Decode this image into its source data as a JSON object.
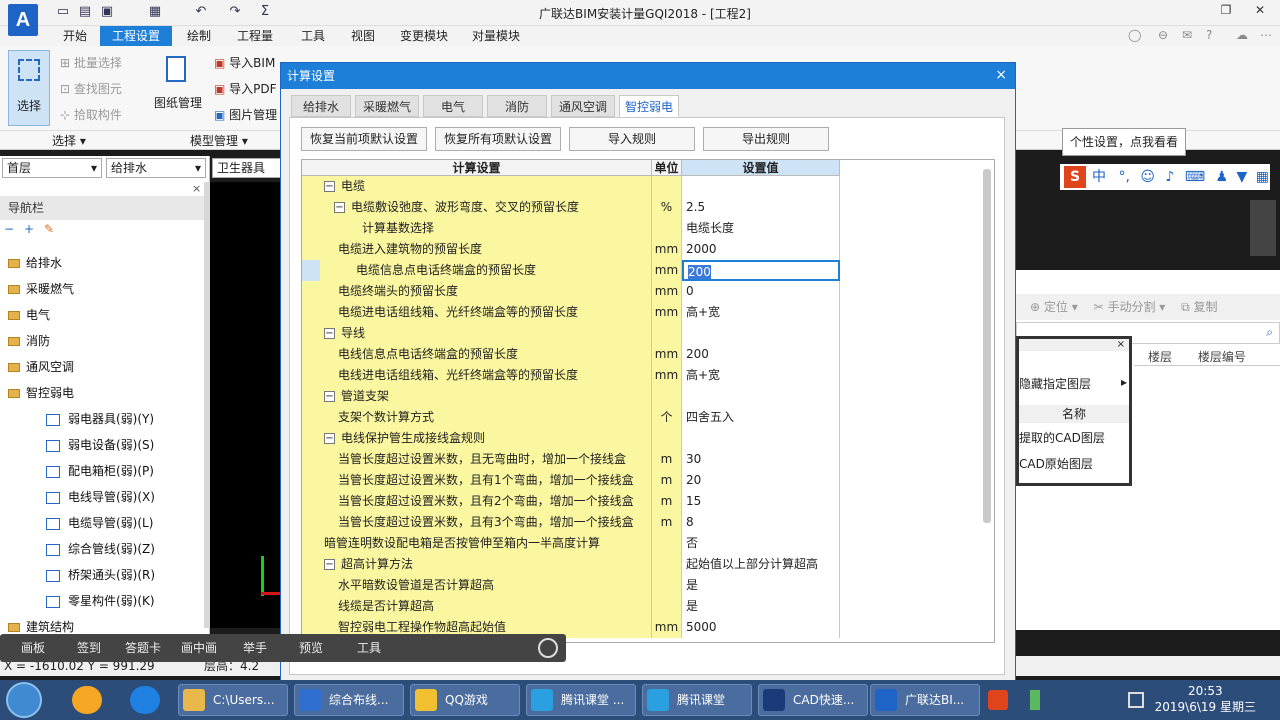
{
  "app": {
    "logo": "A",
    "title": "广联达BIM安装计量GQI2018 - [工程2]"
  },
  "menubar": {
    "tabs": [
      "开始",
      "工程设置",
      "绘制",
      "工程量",
      "工具",
      "视图",
      "变更模块",
      "对量模块"
    ],
    "active_index": 1
  },
  "ribbon": {
    "select_label": "选择",
    "batch_select": "批量选择",
    "find_elem": "查找图元",
    "pick_comp": "拾取构件",
    "drawing_mgmt": "图纸管理",
    "import_bim": "导入BIM",
    "import_pdf": "导入PDF",
    "image_mgmt": "图片管理",
    "group_select": "选择",
    "group_model": "模型管理"
  },
  "left": {
    "floor_value": "首层",
    "discipline_value": "给排水",
    "component_value": "卫生器具(水",
    "nav_title": "导航栏",
    "items": [
      {
        "label": "给排水",
        "level": 0
      },
      {
        "label": "采暖燃气",
        "level": 0
      },
      {
        "label": "电气",
        "level": 0
      },
      {
        "label": "消防",
        "level": 0
      },
      {
        "label": "通风空调",
        "level": 0
      },
      {
        "label": "智控弱电",
        "level": 0
      },
      {
        "label": "弱电器具(弱)(Y)",
        "level": 1
      },
      {
        "label": "弱电设备(弱)(S)",
        "level": 1
      },
      {
        "label": "配电箱柜(弱)(P)",
        "level": 1
      },
      {
        "label": "电线导管(弱)(X)",
        "level": 1
      },
      {
        "label": "电缆导管(弱)(L)",
        "level": 1
      },
      {
        "label": "综合管线(弱)(Z)",
        "level": 1
      },
      {
        "label": "桥架通头(弱)(R)",
        "level": 1
      },
      {
        "label": "零星构件(弱)(K)",
        "level": 1
      },
      {
        "label": "建筑结构",
        "level": 0
      }
    ]
  },
  "dialog": {
    "title": "计算设置",
    "close": "×",
    "tabs": [
      "给排水",
      "采暖燃气",
      "电气",
      "消防",
      "通风空调",
      "智控弱电"
    ],
    "active_tab": 5,
    "buttons": {
      "restore_current": "恢复当前项默认设置",
      "restore_all": "恢复所有项默认设置",
      "import_rules": "导入规则",
      "export_rules": "导出规则"
    },
    "grid_headers": {
      "name": "计算设置",
      "unit": "单位",
      "value": "设置值"
    },
    "rows": [
      {
        "name": "电缆",
        "unit": "",
        "value": "",
        "indent": 0,
        "toggle": "−"
      },
      {
        "name": "电缆敷设弛度、波形弯度、交叉的预留长度",
        "unit": "%",
        "value": "2.5",
        "indent": 1,
        "toggle": "−"
      },
      {
        "name": "计算基数选择",
        "unit": "",
        "value": "电缆长度",
        "indent": 2,
        "toggle": ""
      },
      {
        "name": "电缆进入建筑物的预留长度",
        "unit": "mm",
        "value": "2000",
        "indent": 1,
        "toggle": ""
      },
      {
        "name": "电缆信息点电话终端盒的预留长度",
        "unit": "mm",
        "value": "200",
        "indent": 1,
        "toggle": "",
        "selected": true
      },
      {
        "name": "电缆终端头的预留长度",
        "unit": "mm",
        "value": "0",
        "indent": 1,
        "toggle": ""
      },
      {
        "name": "电缆进电话组线箱、光纤终端盒等的预留长度",
        "unit": "mm",
        "value": "高+宽",
        "indent": 1,
        "toggle": ""
      },
      {
        "name": "导线",
        "unit": "",
        "value": "",
        "indent": 0,
        "toggle": "−"
      },
      {
        "name": "电线信息点电话终端盒的预留长度",
        "unit": "mm",
        "value": "200",
        "indent": 1,
        "toggle": ""
      },
      {
        "name": "电线进电话组线箱、光纤终端盒等的预留长度",
        "unit": "mm",
        "value": "高+宽",
        "indent": 1,
        "toggle": ""
      },
      {
        "name": "管道支架",
        "unit": "",
        "value": "",
        "indent": 0,
        "toggle": "−"
      },
      {
        "name": "支架个数计算方式",
        "unit": "个",
        "value": "四舍五入",
        "indent": 1,
        "toggle": ""
      },
      {
        "name": "电线保护管生成接线盒规则",
        "unit": "",
        "value": "",
        "indent": 0,
        "toggle": "−"
      },
      {
        "name": "当管长度超过设置米数，且无弯曲时，增加一个接线盒",
        "unit": "m",
        "value": "30",
        "indent": 1,
        "toggle": ""
      },
      {
        "name": "当管长度超过设置米数，且有1个弯曲，增加一个接线盒",
        "unit": "m",
        "value": "20",
        "indent": 1,
        "toggle": ""
      },
      {
        "name": "当管长度超过设置米数，且有2个弯曲，增加一个接线盒",
        "unit": "m",
        "value": "15",
        "indent": 1,
        "toggle": ""
      },
      {
        "name": "当管长度超过设置米数，且有3个弯曲，增加一个接线盒",
        "unit": "m",
        "value": "8",
        "indent": 1,
        "toggle": ""
      },
      {
        "name": "暗管连明数设配电箱是否按管伸至箱内一半高度计算",
        "unit": "",
        "value": "否",
        "indent": 0,
        "toggle": ""
      },
      {
        "name": "超高计算方法",
        "unit": "",
        "value": "起始值以上部分计算超高",
        "indent": 0,
        "toggle": "−"
      },
      {
        "name": "水平暗数设管道是否计算超高",
        "unit": "",
        "value": "是",
        "indent": 1,
        "toggle": ""
      },
      {
        "name": "线缆是否计算超高",
        "unit": "",
        "value": "是",
        "indent": 1,
        "toggle": ""
      },
      {
        "name": "智控弱电工程操作物超高起始值",
        "unit": "mm",
        "value": "5000",
        "indent": 1,
        "toggle": ""
      }
    ]
  },
  "right": {
    "tooltip": "个性设置，点我看看",
    "ime_logo": "S",
    "ime_mode": "中",
    "locate": "定位",
    "manual_split": "手动分割",
    "copy": "复制",
    "col_floor": "楼层",
    "col_floor_no": "楼层编号",
    "hide_layers": "隐藏指定图层",
    "col_name": "名称",
    "extracted_cad": "提取的CAD图层",
    "original_layer": "CAD原始图层"
  },
  "floatbar": {
    "items": [
      "画板",
      "签到",
      "答题卡",
      "画中画",
      "举手",
      "预览",
      "工具"
    ]
  },
  "statusbar": {
    "coords": "X = -1610.02 Y = 991.29",
    "floor_height": "层高：4.2"
  },
  "taskbar": {
    "items": [
      {
        "label": "C:\\Users...",
        "color": "#e8b84a"
      },
      {
        "label": "综合布线...",
        "color": "#2e6fd0"
      },
      {
        "label": "QQ游戏",
        "color": "#f0c030"
      },
      {
        "label": "腾讯课堂 ...",
        "color": "#2ba0e0"
      },
      {
        "label": "腾讯课堂",
        "color": "#2ba0e0"
      },
      {
        "label": "CAD快速...",
        "color": "#1a3a7a"
      },
      {
        "label": "广联达BI...",
        "color": "#1e63c6"
      }
    ],
    "time": "20:53",
    "date": "2019\\6\\19 星期三"
  }
}
